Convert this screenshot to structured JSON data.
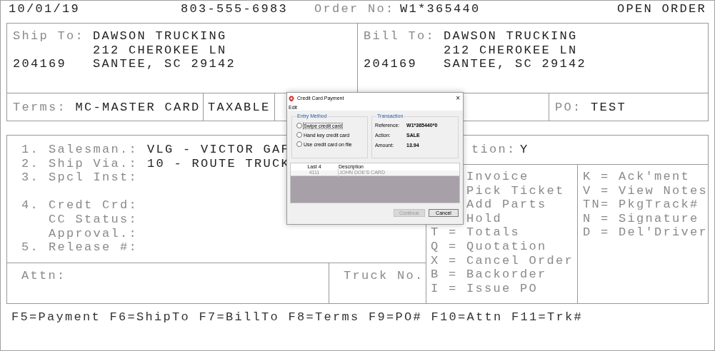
{
  "header": {
    "date": "10/01/19",
    "phone": "803-555-6983",
    "order_label": "Order No:",
    "order_number": "W1*365440",
    "status": "OPEN ORDER"
  },
  "ship_to": {
    "label": "Ship To:",
    "name": "DAWSON TRUCKING",
    "street": "212 CHEROKEE LN",
    "account": "204169",
    "city": "SANTEE, SC 29142"
  },
  "bill_to": {
    "label": "Bill To:",
    "name": "DAWSON TRUCKING",
    "street": "212 CHEROKEE LN",
    "account": "204169",
    "city": "SANTEE, SC 29142"
  },
  "terms": {
    "label": "Terms:",
    "value": "MC-MASTER CARD",
    "tax": "TAXABLE",
    "po_label": "PO:",
    "po_value": "TEST"
  },
  "order_fields": [
    {
      "kind": "field",
      "number": "1.",
      "label": "Salesman.:",
      "value": "VLG - VICTOR GAF"
    },
    {
      "kind": "field",
      "number": "2.",
      "label": "Ship Via.:",
      "value": "10 - ROUTE TRUCK"
    },
    {
      "kind": "field",
      "number": "3.",
      "label": "Spcl Inst:"
    },
    {
      "kind": "blank"
    },
    {
      "kind": "field",
      "number": "4.",
      "label": "Credt Crd:"
    },
    {
      "kind": "field",
      "label": "CC Status:"
    },
    {
      "kind": "field",
      "label": "Approval.:"
    },
    {
      "kind": "field",
      "number": "5.",
      "label": "Release #:"
    }
  ],
  "option_field": {
    "label": "tion:",
    "value": "Y"
  },
  "commands_left": [
    {
      "label": "Invoice"
    },
    {
      "label": "Pick Ticket"
    },
    {
      "label": "Add Parts"
    },
    {
      "label": "Hold"
    },
    {
      "key": "T =",
      "label": "Totals"
    },
    {
      "key": "Q =",
      "label": "Quotation"
    },
    {
      "key": "X =",
      "label": "Cancel Order"
    },
    {
      "key": "B =",
      "label": "Backorder"
    },
    {
      "key": "I =",
      "label": "Issue PO"
    }
  ],
  "commands_right": [
    {
      "key": "K =",
      "label": "Ack'ment"
    },
    {
      "key": "V =",
      "label": "View Notes"
    },
    {
      "key": "TN=",
      "label": "PkgTrack#"
    },
    {
      "key": "N =",
      "label": "Signature"
    },
    {
      "key": "D =",
      "label": "Del'Driver"
    }
  ],
  "attn_label": "Attn:",
  "truck_label": "Truck No.",
  "function_keys": "F5=Payment F6=ShipTo F7=BillTo F8=Terms F9=PO# F10=Attn F11=Trk#",
  "dialog": {
    "title": "Credit Card Payment",
    "close": "×",
    "menu": [
      "Edit"
    ],
    "entry_method": {
      "title": "Entry Method",
      "options": [
        {
          "label": "Swipe credit card",
          "selected": false,
          "focused": true
        },
        {
          "label": "Hand key credit card",
          "selected": false,
          "focused": false
        },
        {
          "label": "Use credit card on file",
          "selected": false,
          "focused": false
        }
      ]
    },
    "transaction": {
      "title": "Transaction",
      "fields": [
        {
          "label": "Reference:",
          "value": "W1*365440*0"
        },
        {
          "label": "Action:",
          "value": "SALE"
        },
        {
          "label": "Amount:",
          "value": "13.94"
        }
      ]
    },
    "cards": {
      "columns": [
        "Last 4",
        "Description"
      ],
      "rows": [
        [
          "4111",
          "JOHN DOE'S CARD"
        ]
      ]
    },
    "buttons": [
      {
        "label": "Continue",
        "disabled": true
      },
      {
        "label": "Cancel",
        "disabled": false
      }
    ]
  }
}
